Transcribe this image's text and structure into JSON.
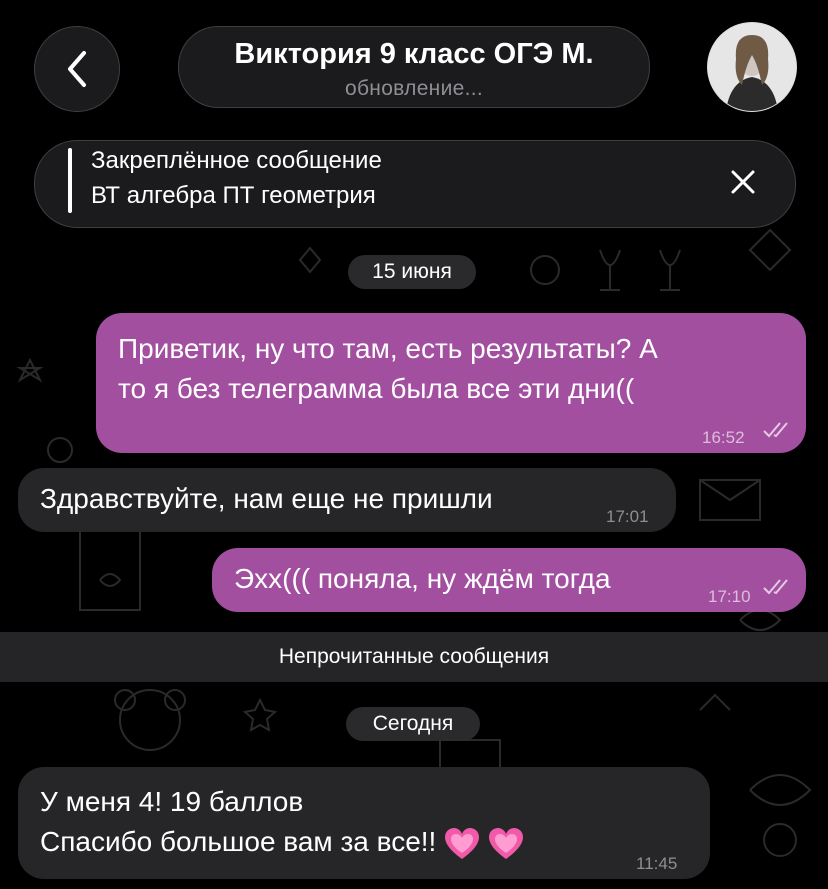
{
  "header": {
    "chat_name": "Виктория 9 класс ОГЭ М.",
    "status": "обновление...",
    "back_icon": "chevron-left-icon",
    "avatar": "contact-avatar"
  },
  "pinned": {
    "title": "Закреплённое сообщение",
    "text": "ВТ алгебра ПТ геометрия",
    "close_icon": "close-icon"
  },
  "dates": {
    "first": "15 июня",
    "second": "Сегодня"
  },
  "messages": [
    {
      "direction": "out",
      "line1": "Приветик, ну что там, есть результаты? А",
      "line2": "то я без телеграмма была все эти дни((",
      "time": "16:52",
      "status": "read"
    },
    {
      "direction": "in",
      "text": "Здравствуйте, нам еще не пришли",
      "time": "17:01"
    },
    {
      "direction": "out",
      "text": "Эхх((( поняла, ну ждём тогда",
      "time": "17:10",
      "status": "read"
    },
    {
      "direction": "in",
      "line1": "У меня 4! 19 баллов",
      "line2": "Спасибо большое вам за все!!",
      "time": "11:45",
      "emoji": "sparkling-heart-icon"
    }
  ],
  "unread_separator": "Непрочитанные сообщения",
  "colors": {
    "background": "#000000",
    "outgoing_bubble": "#a34fa0",
    "incoming_bubble": "#262628",
    "pill": "#1c1c1e"
  }
}
